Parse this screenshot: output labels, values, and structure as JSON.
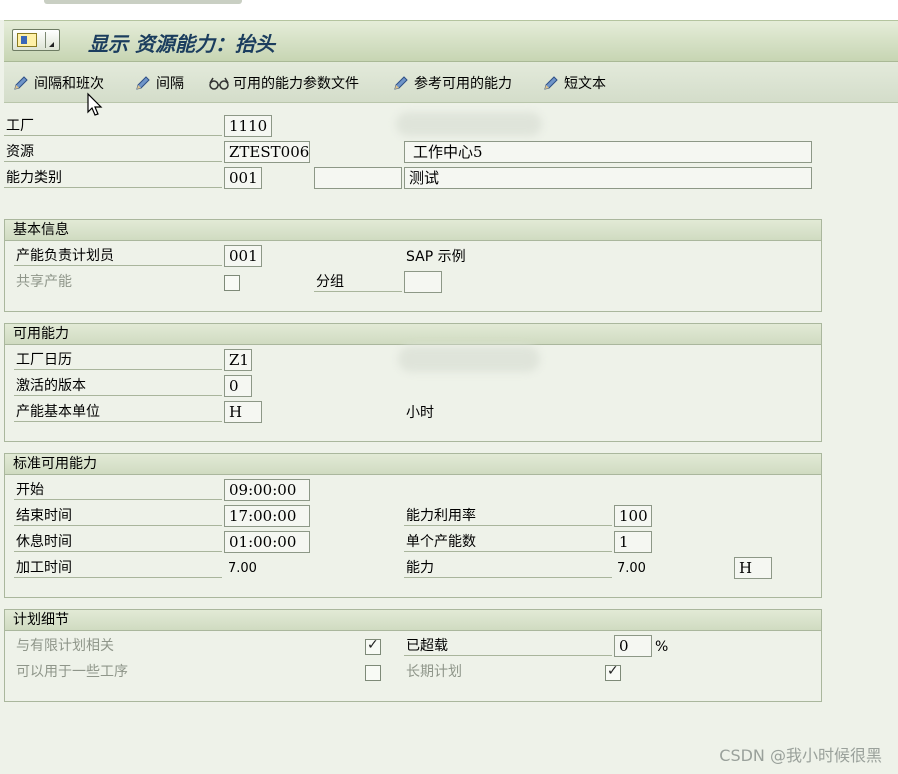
{
  "window": {
    "title": "显示 资源能力：抬头"
  },
  "toolbar": {
    "items": [
      {
        "label": "间隔和班次",
        "icon": "pencil-icon"
      },
      {
        "label": "间隔",
        "icon": "pencil-icon"
      },
      {
        "label": "可用的能力参数文件",
        "icon": "glasses-icon"
      },
      {
        "label": "参考可用的能力",
        "icon": "pencil-icon"
      },
      {
        "label": "短文本",
        "icon": "pencil-icon"
      }
    ]
  },
  "header": {
    "plant_label": "工厂",
    "plant_value": "1110",
    "resource_label": "资源",
    "resource_value": "ZTEST006",
    "resource_desc": "工作中心5",
    "capacity_cat_label": "能力类别",
    "capacity_cat_value": "001",
    "capacity_cat_extra": "",
    "capacity_cat_desc": "测试"
  },
  "basic": {
    "title": "基本信息",
    "planner_label": "产能负责计划员",
    "planner_value": "001",
    "planner_desc": "SAP 示例",
    "shared_label": "共享产能",
    "shared_checked": false,
    "group_label": "分组",
    "group_value": ""
  },
  "available": {
    "title": "可用能力",
    "factory_calendar_label": "工厂日历",
    "factory_calendar_value": "Z1",
    "active_version_label": "激活的版本",
    "active_version_value": "0",
    "base_unit_label": "产能基本单位",
    "base_unit_value": "H",
    "base_unit_desc": "小时"
  },
  "standard": {
    "title": "标准可用能力",
    "start_label": "开始",
    "start_value": "09:00:00",
    "end_label": "结束时间",
    "end_value": "17:00:00",
    "break_label": "休息时间",
    "break_value": "01:00:00",
    "processing_label": "加工时间",
    "processing_value": "7.00",
    "utilization_label": "能力利用率",
    "utilization_value": "100",
    "individual_label": "单个产能数",
    "individual_value": "1",
    "capacity_label": "能力",
    "capacity_value": "7.00",
    "capacity_unit": "H"
  },
  "planning": {
    "title": "计划细节",
    "finite_label": "与有限计划相关",
    "finite_checked": true,
    "overload_label": "已超载",
    "overload_value": "0",
    "overload_unit": "%",
    "multi_ops_label": "可以用于一些工序",
    "multi_ops_checked": false,
    "longterm_label": "长期计划",
    "longterm_checked": true
  },
  "watermark": "CSDN @我小时候很黑"
}
